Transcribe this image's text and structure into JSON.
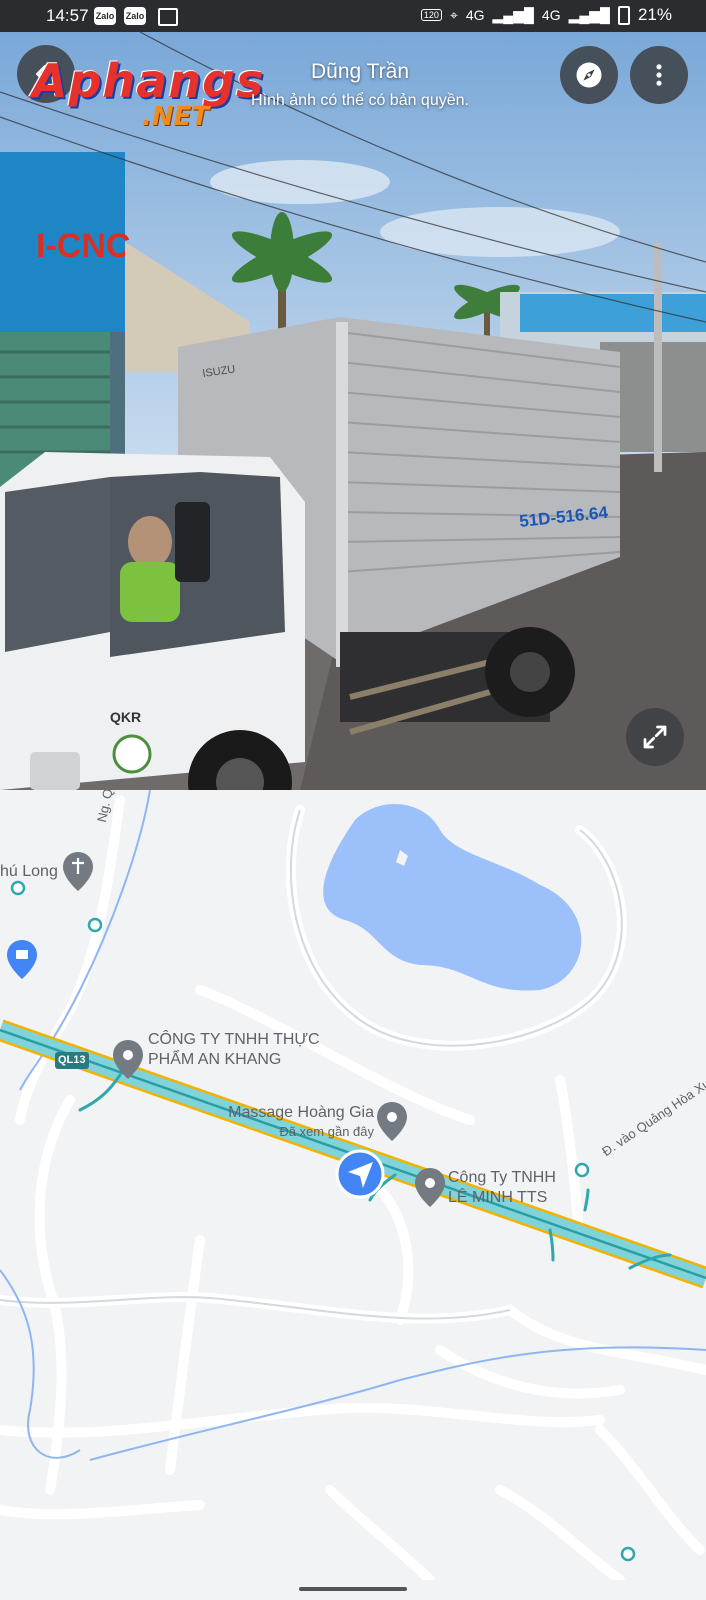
{
  "status_bar": {
    "time": "14:57",
    "app_icons": [
      "Zalo",
      "Zalo"
    ],
    "network": "4G",
    "network2": "4G",
    "battery": "21%"
  },
  "street_view": {
    "title": "Dũng Trần",
    "subtitle": "Hình ảnh có thể có bản quyền.",
    "watermark_logo": "Aphangs",
    "watermark_suffix": ".NET",
    "sign_text": "I-CNC",
    "truck_brand": "ISUZU",
    "plate": "51D-516.64"
  },
  "map": {
    "road_ql13": "QL13",
    "road_ng_quy": "Ng. Quy",
    "road_quang_hoa": "Đ. vào Quảng Hòa Xương",
    "poi_church": "hú Long",
    "poi_an_khang_line1": "CÔNG TY TNHH THỰC",
    "poi_an_khang_line2": "PHẨM AN KHANG",
    "poi_massage": "Massage Hoàng Gia",
    "poi_massage_sub": "Đã xem gần đây",
    "poi_le_minh_line1": "Công Ty TNHH",
    "poi_le_minh_line2": "LÊ MINH TTS"
  },
  "colors": {
    "map_bg": "#f1f3f4",
    "road": "#ffffff",
    "highway_fill": "#7fd3d9",
    "highway_edge": "#f2b300",
    "water": "#9cc0f9",
    "accent": "#4285f4"
  },
  "icons": [
    "compass-icon",
    "more-vert-icon",
    "expand-icon",
    "pin-icon",
    "church-icon",
    "shopping-icon",
    "my-location-arrow-icon"
  ]
}
